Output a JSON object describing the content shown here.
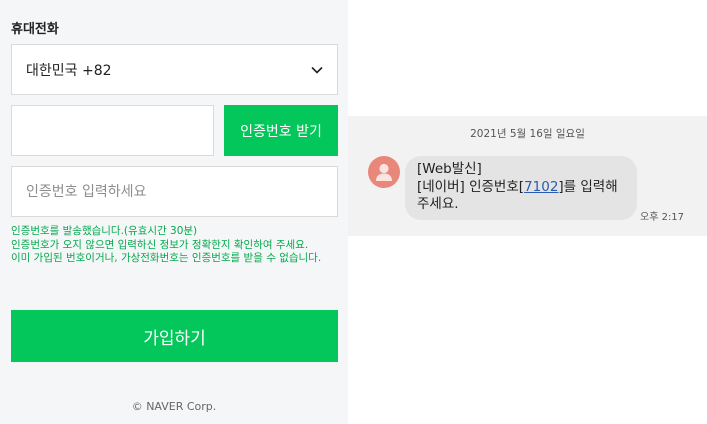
{
  "form": {
    "section_label": "휴대전화",
    "country_value": "대한민국 +82",
    "phone_value": "",
    "get_code_label": "인증번호 받기",
    "code_placeholder": "인증번호 입력하세요",
    "notice_lines": [
      "인증번호를 발송했습니다.(유효시간 30분)",
      "인증번호가 오지 않으면 입력하신 정보가 정확한지 확인하여 주세요.",
      "이미 가입된 번호이거나, 가상전화번호는 인증번호를 받을 수 없습니다."
    ],
    "join_label": "가입하기",
    "footer": "© NAVER Corp."
  },
  "sms": {
    "date": "2021년 5월 16일 일요일",
    "line1": "[Web발신]",
    "line2_prefix": "[네이버] 인증번호[",
    "code": "7102",
    "line2_suffix": "]를 입력해",
    "line3": "주세요.",
    "time": "오후 2:17"
  },
  "icons": {
    "country_chevron": "chevron-down-icon",
    "sender_avatar": "person-icon"
  },
  "colors": {
    "naver_green": "#03c75a",
    "notice_green": "#03a94d",
    "avatar": "#e8877a"
  }
}
